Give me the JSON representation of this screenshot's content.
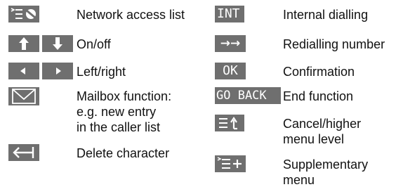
{
  "colors": {
    "key_background": "#6f6f6f",
    "key_symbol": "#ffffff",
    "text": "#111111"
  },
  "left_column": [
    {
      "icon": "network-access-list-icon",
      "label": "Network access list"
    },
    {
      "icon": "up-down-arrow-keys-icon",
      "label": "On/off"
    },
    {
      "icon": "left-right-arrow-keys-icon",
      "label": "Left/right"
    },
    {
      "icon": "mailbox-envelope-icon",
      "label_lines": [
        "Mailbox function:",
        "e.g. new entry",
        "in the caller list"
      ]
    },
    {
      "icon": "delete-character-icon",
      "label": "Delete character"
    }
  ],
  "right_column": [
    {
      "key_text": "INT",
      "label": "Internal dialling"
    },
    {
      "icon": "redial-arrows-icon",
      "key_text": "→→",
      "label": "Redialling number"
    },
    {
      "key_text": "OK",
      "label": "Confirmation"
    },
    {
      "key_text": "GO BACK",
      "label": "End function"
    },
    {
      "icon": "cancel-menu-icon",
      "label_lines": [
        "Cancel/higher",
        "menu level"
      ]
    },
    {
      "icon": "supplementary-menu-icon",
      "label_lines": [
        "Supplementary",
        "menu"
      ]
    }
  ]
}
